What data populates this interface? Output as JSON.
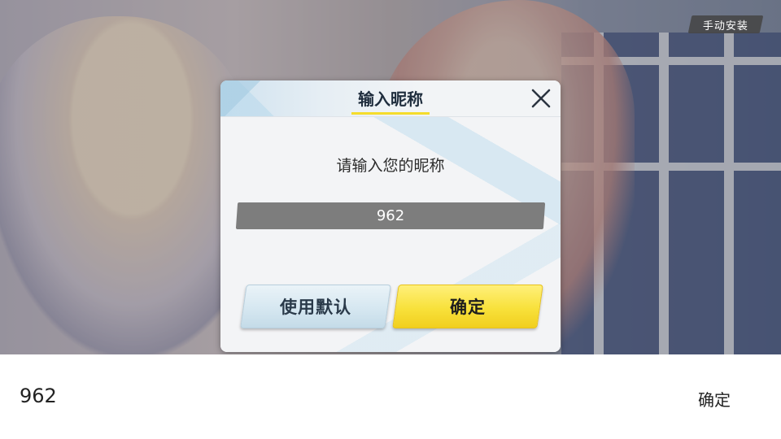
{
  "top_right": {
    "manual_install_label": "手动安装"
  },
  "dialog": {
    "title": "输入昵称",
    "prompt": "请输入您的昵称",
    "nickname_value": "962",
    "use_default_label": "使用默认",
    "confirm_label": "确定",
    "close_icon": "close-icon"
  },
  "ime_bar": {
    "input_value": "962",
    "confirm_label": "确定"
  },
  "colors": {
    "accent_yellow": "#f5dc2b",
    "confirm_button": "#f8e13b",
    "input_field": "#7d7d7d",
    "title_text": "#1f2d3d"
  }
}
